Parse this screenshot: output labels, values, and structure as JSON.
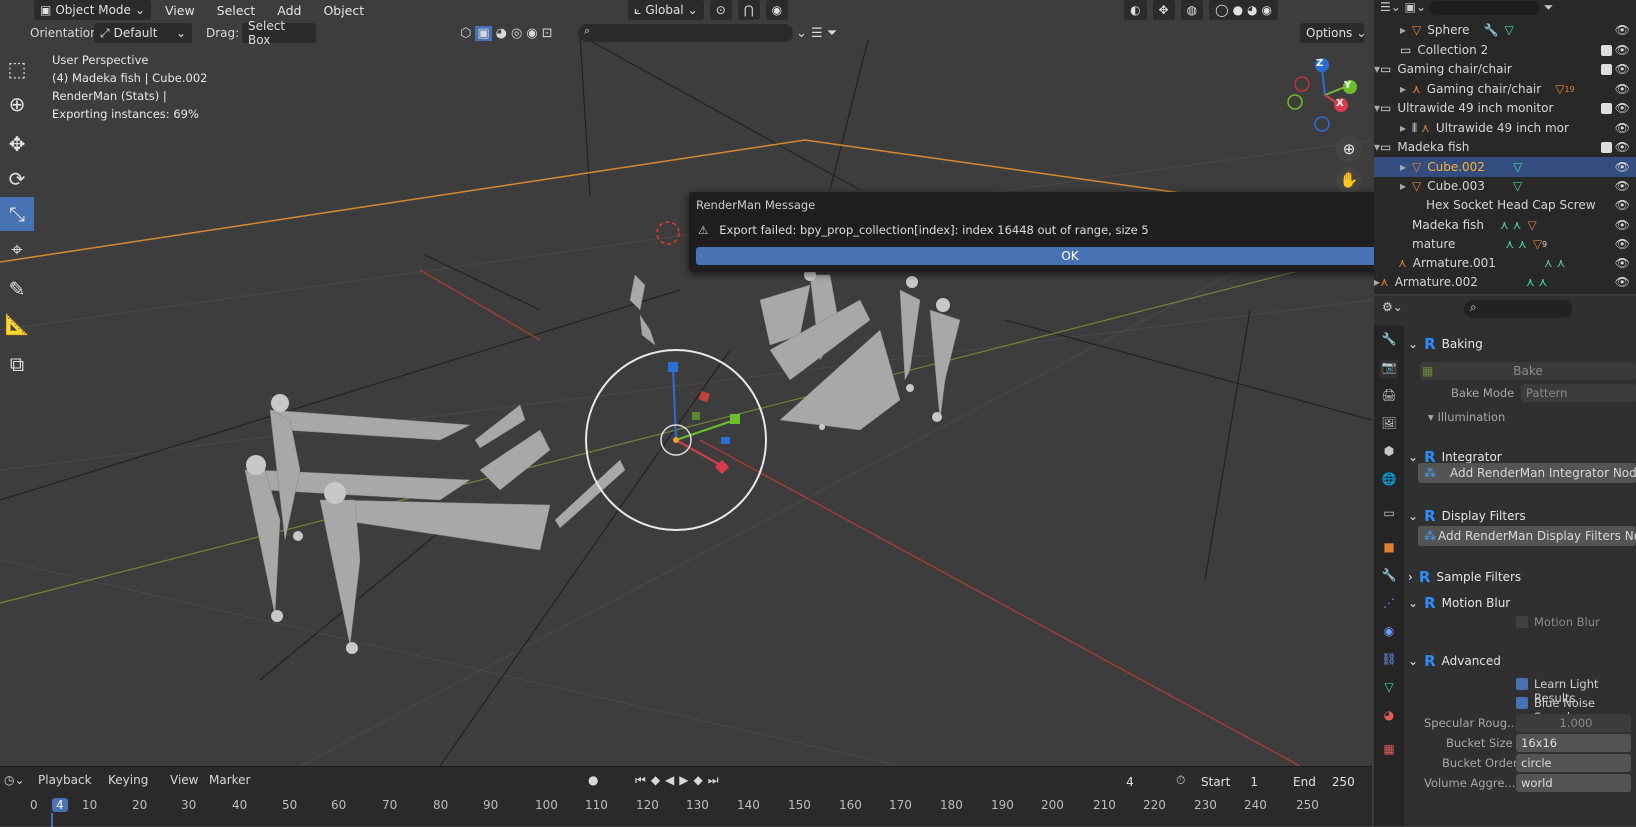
{
  "header": {
    "mode": "Object Mode",
    "menus": [
      "View",
      "Select",
      "Add",
      "Object"
    ],
    "transform": "Global"
  },
  "subheader": {
    "orientation_label": "Orientation:",
    "orientation_value": "Default",
    "drag_label": "Drag:",
    "drag_value": "Select Box",
    "options": "Options"
  },
  "viewport": {
    "info": [
      "User Perspective",
      "(4) Madeka fish | Cube.002",
      "RenderMan (Stats) |",
      "Exporting instances: 69%"
    ],
    "gizmo_axes": [
      "Z",
      "Y",
      "X"
    ]
  },
  "dialog": {
    "title": "RenderMan Message",
    "message": "Export failed: bpy_prop_collection[index]: index 16448 out of range, size 5",
    "ok": "OK"
  },
  "outliner": {
    "rows": [
      {
        "label": "Sphere"
      },
      {
        "label": "Collection 2"
      },
      {
        "label": "Gaming chair/chair"
      },
      {
        "label": "Gaming chair/chair"
      },
      {
        "label": "Ultrawide 49 inch monitor"
      },
      {
        "label": "Ultrawide 49 inch mor"
      },
      {
        "label": "Madeka fish"
      },
      {
        "label": "Cube.002"
      },
      {
        "label": "Cube.003"
      },
      {
        "label": "Hex Socket Head Cap Screw"
      },
      {
        "label": "Madeka fish"
      },
      {
        "label": "mature"
      },
      {
        "label": "Armature.001"
      },
      {
        "label": "Armature.002"
      }
    ],
    "badge_19": "19",
    "badge_9": "9"
  },
  "properties": {
    "baking": "Baking",
    "bake_button": "Bake",
    "bake_mode_label": "Bake Mode",
    "bake_mode_value": "Pattern",
    "illumination": "Illumination",
    "integrator": "Integrator",
    "integrator_button": "Add RenderMan Integrator Nodetree",
    "display_filters": "Display Filters",
    "display_filters_button": "Add RenderMan Display Filters Nodetree",
    "sample_filters": "Sample Filters",
    "motion_blur": "Motion Blur",
    "motion_blur_check": "Motion Blur",
    "advanced": "Advanced",
    "learn_light": "Learn Light Results",
    "blue_noise": "Blue Noise Samples",
    "specular_label": "Specular Roug...",
    "specular_value": "1.000",
    "bucket_size_label": "Bucket Size",
    "bucket_size_value": "16x16",
    "bucket_order_label": "Bucket Order",
    "bucket_order_value": "circle",
    "volume_label": "Volume Aggre...",
    "volume_value": "world"
  },
  "timeline": {
    "playback": "Playback",
    "keying": "Keying",
    "view": "View",
    "marker": "Marker",
    "current_frame": "4",
    "start_label": "Start",
    "start": "1",
    "end_label": "End",
    "end": "250",
    "ticks": [
      "0",
      "4",
      "10",
      "20",
      "30",
      "40",
      "50",
      "60",
      "70",
      "80",
      "90",
      "100",
      "110",
      "120",
      "130",
      "140",
      "150",
      "160",
      "170",
      "180",
      "190",
      "200",
      "210",
      "220",
      "230",
      "240",
      "250"
    ]
  },
  "colors": {
    "accent": "#4772b3",
    "selected": "#334d80",
    "renderman": "#2a8cff",
    "orange": "#e0802a"
  }
}
